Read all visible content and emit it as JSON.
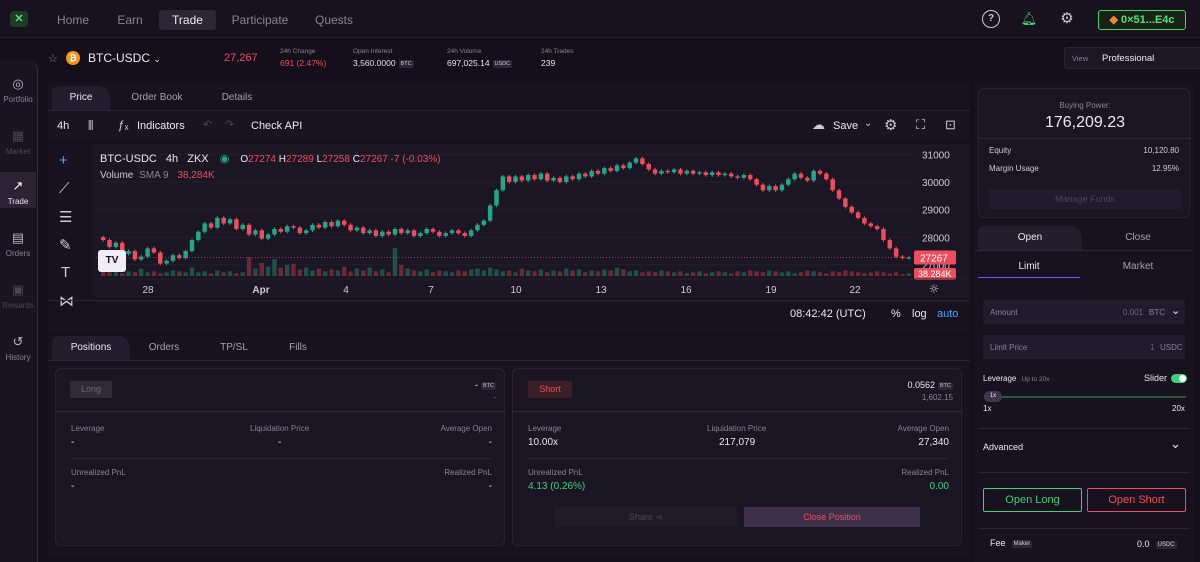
{
  "nav": {
    "items": [
      "Home",
      "Earn",
      "Trade",
      "Participate",
      "Quests"
    ],
    "active": "Trade",
    "wallet": "0×51...E4c"
  },
  "sidebar": [
    {
      "label": "Portfolio",
      "icon": "user-circle-icon",
      "glyph": "◎"
    },
    {
      "label": "Market",
      "icon": "store-icon",
      "glyph": "▦"
    },
    {
      "label": "Trade",
      "icon": "chart-trend-icon",
      "glyph": "↗"
    },
    {
      "label": "Orders",
      "icon": "orders-icon",
      "glyph": "▤"
    },
    {
      "label": "Rewards",
      "icon": "gift-icon",
      "glyph": "▣"
    },
    {
      "label": "History",
      "icon": "history-icon",
      "glyph": "↺"
    }
  ],
  "ticker": {
    "pair": "BTC-USDC",
    "price": "27,267",
    "change_label": "24h Change",
    "change_value": "691 (2.47%)",
    "oi_label": "Open Interest",
    "oi_value": "3,560.0000",
    "oi_unit": "BTC",
    "vol_label": "24h Volume",
    "vol_value": "697,025.14",
    "vol_unit": "USDC",
    "trades_label": "24h Trades",
    "trades_value": "239",
    "view_label": "View",
    "view_value": "Professional"
  },
  "chart_tabs": [
    "Price",
    "Order Book",
    "Details"
  ],
  "toolbar": {
    "interval": "4h",
    "indicators": "Indicators",
    "check_api": "Check API",
    "save": "Save"
  },
  "chart_legend": {
    "symbol": "BTC-USDC",
    "interval": "4h",
    "exchange": "ZKX",
    "o_label": "O",
    "o": "27274",
    "h_label": "H",
    "h": "27289",
    "l_label": "L",
    "l": "27258",
    "c_label": "C",
    "c": "27267",
    "change": "-7 (-0.03%)",
    "volume_label": "Volume",
    "sma": "SMA 9",
    "volume_value": "38,284K"
  },
  "chart_footer": {
    "time": "08:42:42 (UTC)",
    "pct": "%",
    "log": "log",
    "auto": "auto"
  },
  "chart_data": {
    "type": "candlestick",
    "x_ticks": [
      "28",
      "Apr",
      "4",
      "7",
      "10",
      "13",
      "16",
      "19",
      "22"
    ],
    "y_ticks": [
      27000,
      28000,
      29000,
      30000,
      31000
    ],
    "ylim": [
      26600,
      31300
    ],
    "last_price_label": "27267",
    "last_volume_label": "38.284K",
    "closes": [
      27900,
      27650,
      27800,
      27400,
      27500,
      27200,
      27300,
      27600,
      27450,
      27050,
      27150,
      27350,
      27250,
      27500,
      27900,
      28200,
      28500,
      28350,
      28700,
      28500,
      28650,
      28300,
      28450,
      28100,
      28250,
      27950,
      28100,
      28300,
      28200,
      28400,
      28350,
      28150,
      28250,
      28450,
      28350,
      28550,
      28400,
      28600,
      28450,
      28250,
      28350,
      28150,
      28250,
      28050,
      28200,
      28100,
      28300,
      28150,
      28250,
      28050,
      28150,
      28300,
      28200,
      28050,
      28150,
      28250,
      28150,
      28050,
      28250,
      28450,
      28600,
      29150,
      29700,
      30200,
      30000,
      30200,
      30050,
      30250,
      30100,
      30300,
      30050,
      30150,
      30000,
      30200,
      30100,
      30300,
      30200,
      30400,
      30300,
      30500,
      30400,
      30600,
      30500,
      30700,
      30850,
      30650,
      30450,
      30300,
      30400,
      30350,
      30450,
      30300,
      30400,
      30300,
      30350,
      30250,
      30350,
      30250,
      30300,
      30200,
      30150,
      30250,
      30100,
      29900,
      29700,
      29850,
      29700,
      29900,
      30100,
      30300,
      30150,
      30050,
      30400,
      30300,
      30100,
      29700,
      29400,
      29100,
      28900,
      28700,
      28500,
      28400,
      28300,
      27900,
      27600,
      27300,
      27250,
      27267
    ],
    "volumes": [
      5,
      4,
      6,
      3,
      5,
      4,
      8,
      4,
      5,
      3,
      4,
      6,
      5,
      4,
      9,
      4,
      5,
      3,
      6,
      4,
      5,
      3,
      4,
      20,
      8,
      14,
      10,
      18,
      9,
      12,
      13,
      7,
      9,
      6,
      8,
      5,
      7,
      6,
      10,
      5,
      8,
      6,
      9,
      5,
      7,
      4,
      30,
      12,
      8,
      6,
      5,
      7,
      4,
      6,
      5,
      4,
      6,
      5,
      7,
      8,
      6,
      9,
      7,
      5,
      6,
      4,
      8,
      6,
      5,
      7,
      4,
      6,
      5,
      8,
      6,
      7,
      4,
      6,
      5,
      7,
      6,
      9,
      7,
      5,
      6,
      4,
      5,
      4,
      6,
      5,
      4,
      5,
      3,
      4,
      5,
      3,
      4,
      5,
      4,
      3,
      5,
      4,
      6,
      5,
      4,
      6,
      5,
      4,
      5,
      3,
      4,
      6,
      5,
      4,
      3,
      5,
      4,
      6,
      5,
      4,
      3,
      4,
      5,
      4,
      3,
      4,
      2,
      3
    ]
  },
  "positions": {
    "tabs": [
      "Positions",
      "Orders",
      "TP/SL",
      "Fills"
    ],
    "long": {
      "label": "Long",
      "size": "-",
      "unit": "BTC",
      "usd": "-",
      "leverage_label": "Leverage",
      "leverage": "-",
      "liq_label": "Liquidation Price",
      "liq": "-",
      "avg_label": "Average Open",
      "avg": "-",
      "upnl_label": "Unrealized PnL",
      "upnl": "-",
      "rpnl_label": "Realized PnL",
      "rpnl": "-"
    },
    "short": {
      "label": "Short",
      "size": "0.0562",
      "unit": "BTC",
      "usd": "1,602.15",
      "leverage_label": "Leverage",
      "leverage": "10.00x",
      "liq_label": "Liquidation Price",
      "liq": "217,079",
      "avg_label": "Average Open",
      "avg": "27,340",
      "upnl_label": "Unrealized PnL",
      "upnl": "4.13 (0.26%)",
      "rpnl_label": "Realized PnL",
      "rpnl": "0.00",
      "share": "Share",
      "close": "Close Position"
    }
  },
  "account": {
    "bp_label": "Buying Power:",
    "bp_value": "176,209.23",
    "equity_label": "Equity",
    "equity": "10,120.80",
    "margin_label": "Margin Usage",
    "margin": "12.95%",
    "manage": "Manage Funds"
  },
  "order": {
    "side_tabs": [
      "Open",
      "Close"
    ],
    "type_tabs": [
      "Limit",
      "Market"
    ],
    "amount_label": "Amount",
    "amount_ph": "0.001",
    "amount_unit": "BTC",
    "price_label": "Limit Price",
    "price_ph": "1",
    "price_unit": "USDC",
    "leverage_label": "Leverage",
    "leverage_hint": "Up to 20x",
    "slider_label": "Slider",
    "slider_value": "1x",
    "min": "1x",
    "max": "20x",
    "advanced": "Advanced",
    "open_long": "Open Long",
    "open_short": "Open Short",
    "fee_label": "Fee",
    "fee_type": "Maker",
    "fee_value": "0.0",
    "fee_unit": "USDC"
  },
  "colors": {
    "up": "#22a78b",
    "down": "#ef4d5d",
    "accent": "#3fd07a"
  }
}
